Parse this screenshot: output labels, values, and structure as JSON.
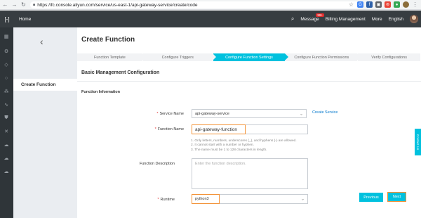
{
  "browser": {
    "url": "https://fc.console.aliyun.com/service/us-east-1/api-gateway-service/create/code"
  },
  "topnav": {
    "home": "Home",
    "message": "Message",
    "badge": "99+",
    "billing": "Billing Management",
    "more": "More",
    "language": "English"
  },
  "leftpanel": {
    "active_item": "Create Function"
  },
  "page": {
    "title": "Create Function",
    "steps": [
      "Function Template",
      "Configure Triggers",
      "Configure Function Settings",
      "Configure Function Permissions",
      "Verify Configurations"
    ],
    "active_step_index": 2,
    "section_title": "Basic Management Configuration",
    "subsection_title": "Function Information"
  },
  "form": {
    "service_name_label": "Service Name",
    "service_name_value": "api-gateway-service",
    "create_service_link": "Create Service",
    "function_name_label": "Function Name",
    "function_name_value": "api-gateway-function",
    "help_line1": "1. Only letters, numbers, underscores (_), and hyphens (-) are allowed.",
    "help_line2": "2. It cannot start with a number or hyphen.",
    "help_line3": "3. The name must be 1 to 128 characters in length.",
    "description_label": "Function Description",
    "description_placeholder": "Enter the function description.",
    "runtime_label": "Runtime",
    "runtime_value": "python3",
    "required_mark": "*"
  },
  "buttons": {
    "previous": "Previous",
    "next": "Next"
  },
  "side": {
    "contact": "Contact Us"
  },
  "colors": {
    "accent": "#00c1de",
    "highlight": "#f39237",
    "topbar": "#373d41",
    "required": "#e12e2e"
  }
}
